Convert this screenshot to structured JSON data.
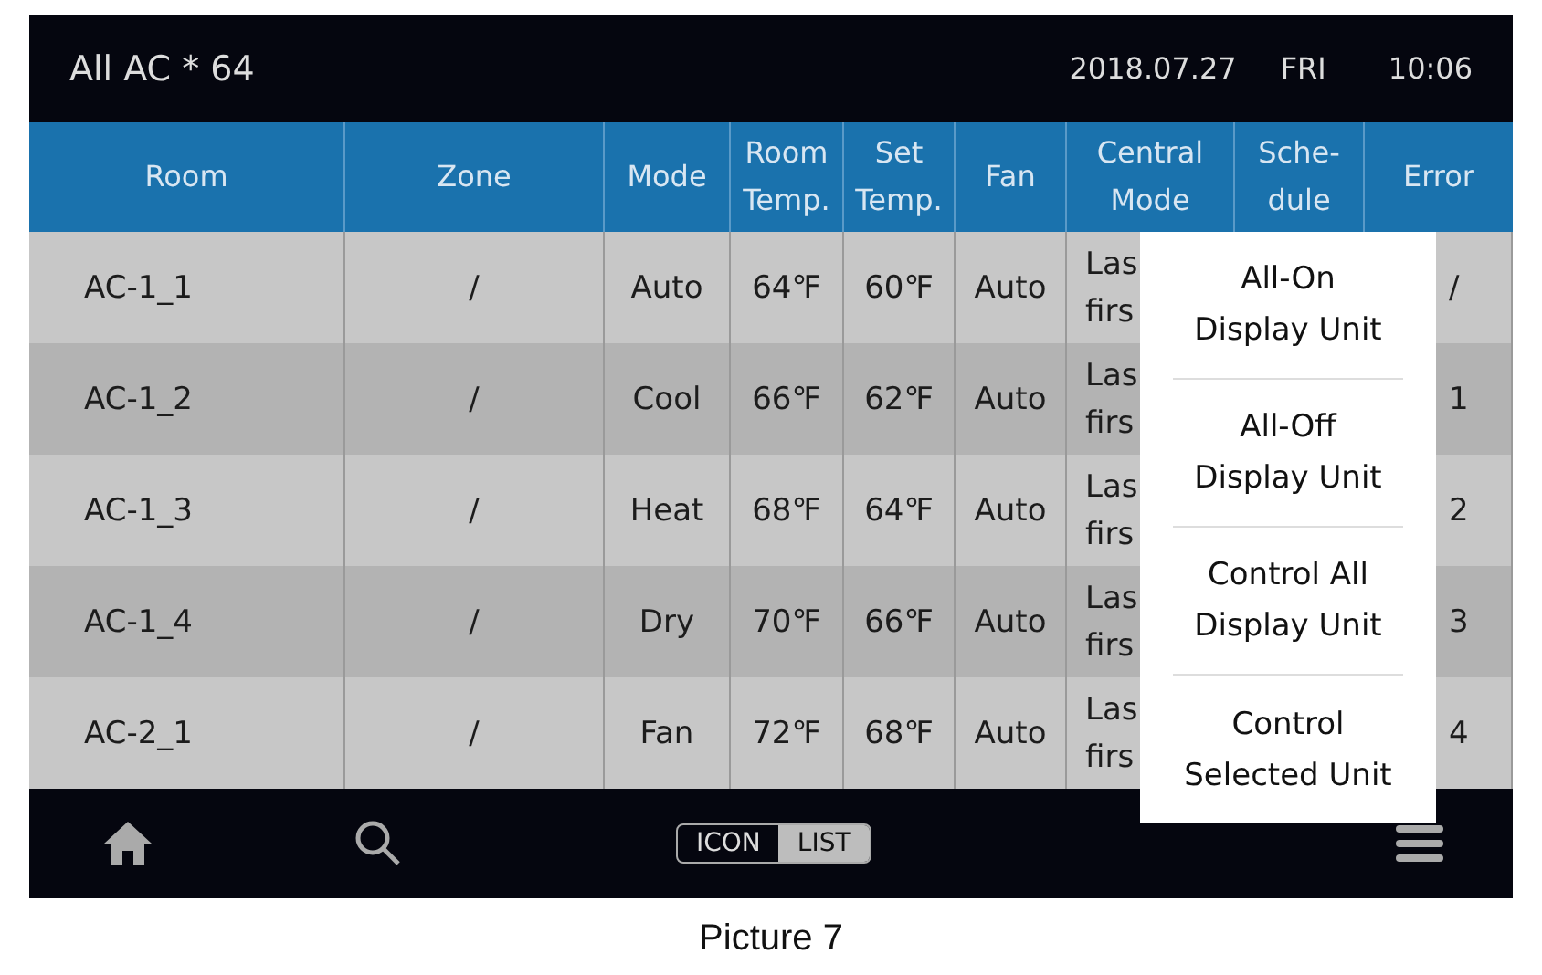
{
  "header": {
    "title": "All AC * 64",
    "date": "2018.07.27",
    "weekday": "FRI",
    "time": "10:06"
  },
  "table": {
    "columns": [
      "Room",
      "Zone",
      "Mode",
      "Room\nTemp.",
      "Set\nTemp.",
      "Fan",
      "Central\nMode",
      "Sche-\ndule",
      "Error"
    ],
    "rows": [
      {
        "room": "AC-1_1",
        "zone": "/",
        "mode": "Auto",
        "room_temp": "64℉",
        "set_temp": "60℉",
        "fan": "Auto",
        "central_mode": "Las\nfirs",
        "error": "/"
      },
      {
        "room": "AC-1_2",
        "zone": "/",
        "mode": "Cool",
        "room_temp": "66℉",
        "set_temp": "62℉",
        "fan": "Auto",
        "central_mode": "Las\nfirs",
        "error": "1"
      },
      {
        "room": "AC-1_3",
        "zone": "/",
        "mode": "Heat",
        "room_temp": "68℉",
        "set_temp": "64℉",
        "fan": "Auto",
        "central_mode": "Las\nfirs",
        "error": "2"
      },
      {
        "room": "AC-1_4",
        "zone": "/",
        "mode": "Dry",
        "room_temp": "70℉",
        "set_temp": "66℉",
        "fan": "Auto",
        "central_mode": "Las\nfirs",
        "error": "3"
      },
      {
        "room": "AC-2_1",
        "zone": "/",
        "mode": "Fan",
        "room_temp": "72℉",
        "set_temp": "68℉",
        "fan": "Auto",
        "central_mode": "Las\nfirs",
        "error": "4"
      }
    ]
  },
  "menu": {
    "items": [
      "All-On\nDisplay Unit",
      "All-Off\nDisplay Unit",
      "Control All\nDisplay Unit",
      "Control\nSelected Unit"
    ]
  },
  "footer": {
    "view_toggle": [
      {
        "label": "ICON",
        "selected": false
      },
      {
        "label": "LIST",
        "selected": true
      }
    ]
  },
  "caption": "Picture 7"
}
